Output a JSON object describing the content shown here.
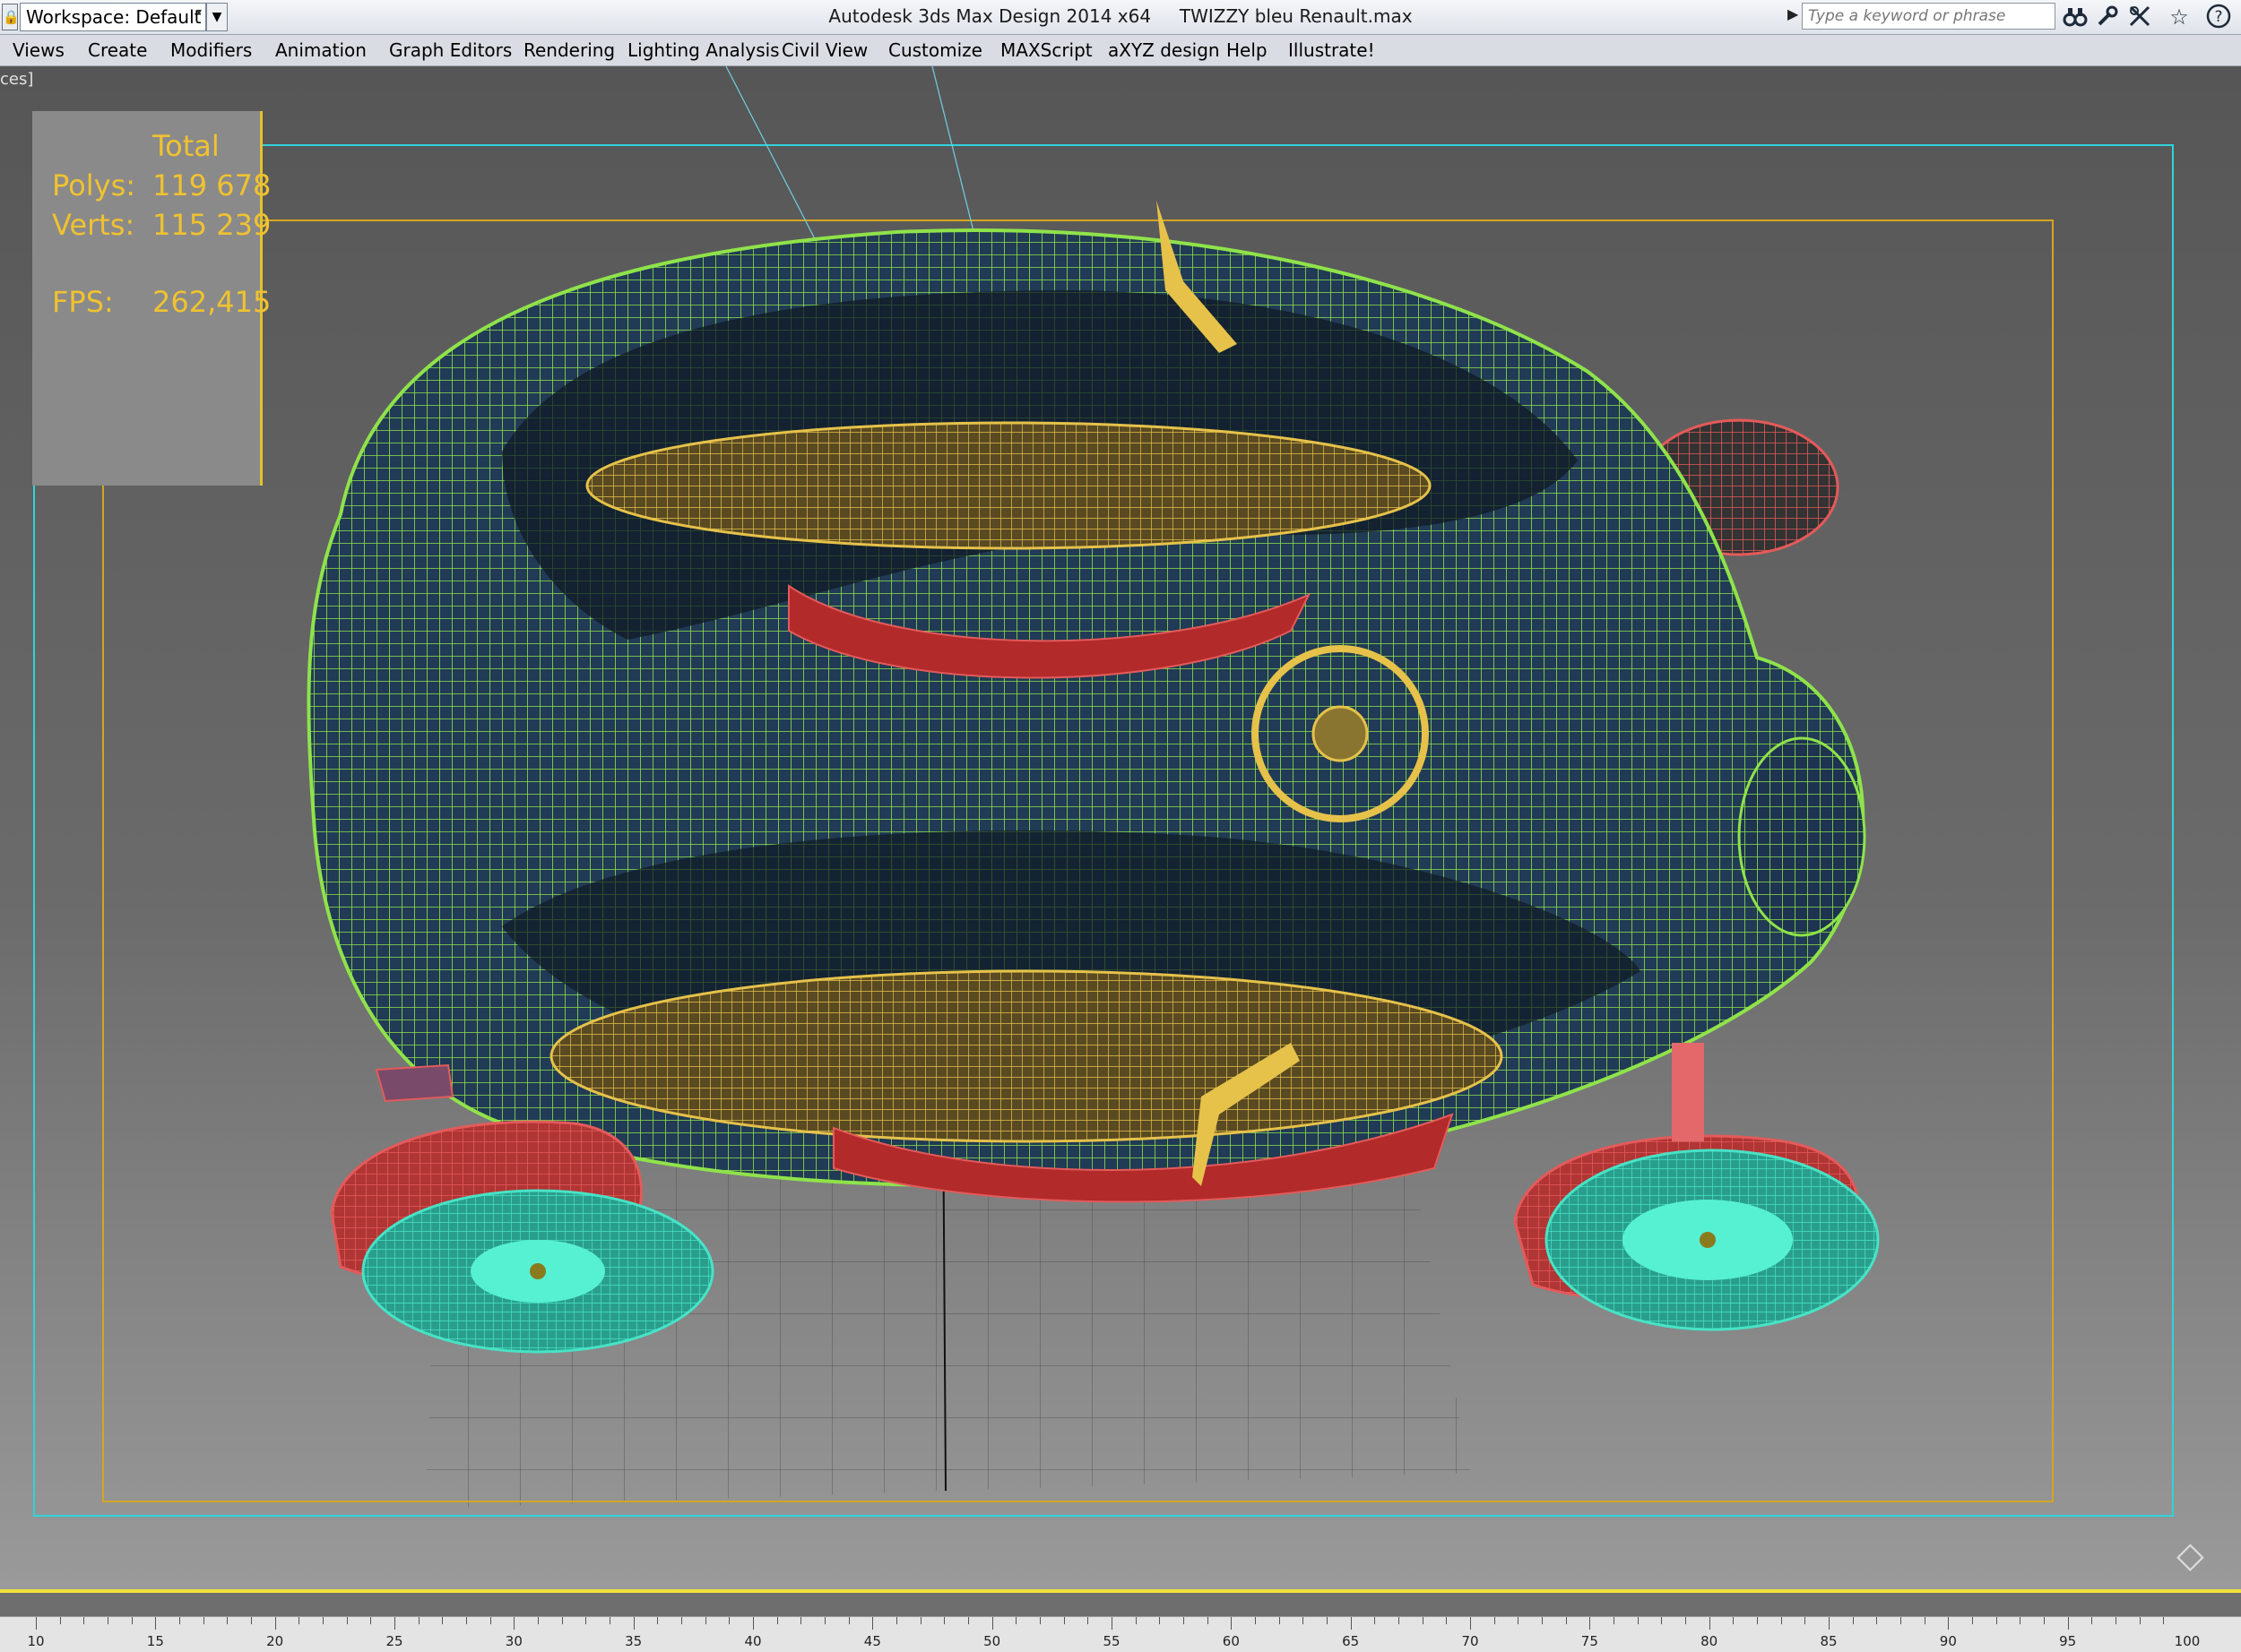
{
  "titlebar": {
    "workspace_label": "Workspace: Default",
    "app_title": "Autodesk 3ds Max Design 2014 x64     TWIZZY bleu Renault.max",
    "search_placeholder": "Type a keyword or phrase",
    "icons": [
      "binoculars-icon",
      "wrench-icon",
      "search-tools-icon",
      "star-icon",
      "help-icon"
    ]
  },
  "menubar": {
    "items": [
      "Views",
      "Create",
      "Modifiers",
      "Animation",
      "Graph Editors",
      "Rendering",
      "Lighting Analysis",
      "Civil View",
      "Customize",
      "MAXScript",
      "aXYZ design",
      "Help",
      "Illustrate!"
    ]
  },
  "viewport": {
    "label_fragment": "ces]",
    "stats": {
      "header": "Total",
      "polys_label": "Polys:",
      "polys_value": "119 678",
      "verts_label": "Verts:",
      "verts_value": "115 239",
      "fps_label": "FPS:",
      "fps_value": "262,415"
    },
    "colors": {
      "body_wire": "#8fe34a",
      "interior_wire": "#e6c24a",
      "tire_wire": "#e45a5a",
      "rim_wire": "#47e3c6",
      "safe_frame": "#d4a523",
      "viewport_frame": "#2fd3db"
    }
  },
  "timeline": {
    "ticks": [
      "10",
      "15",
      "20",
      "25",
      "30",
      "35",
      "40",
      "45",
      "50",
      "55",
      "60",
      "65",
      "70",
      "75",
      "80",
      "85",
      "90",
      "95",
      "100"
    ]
  }
}
